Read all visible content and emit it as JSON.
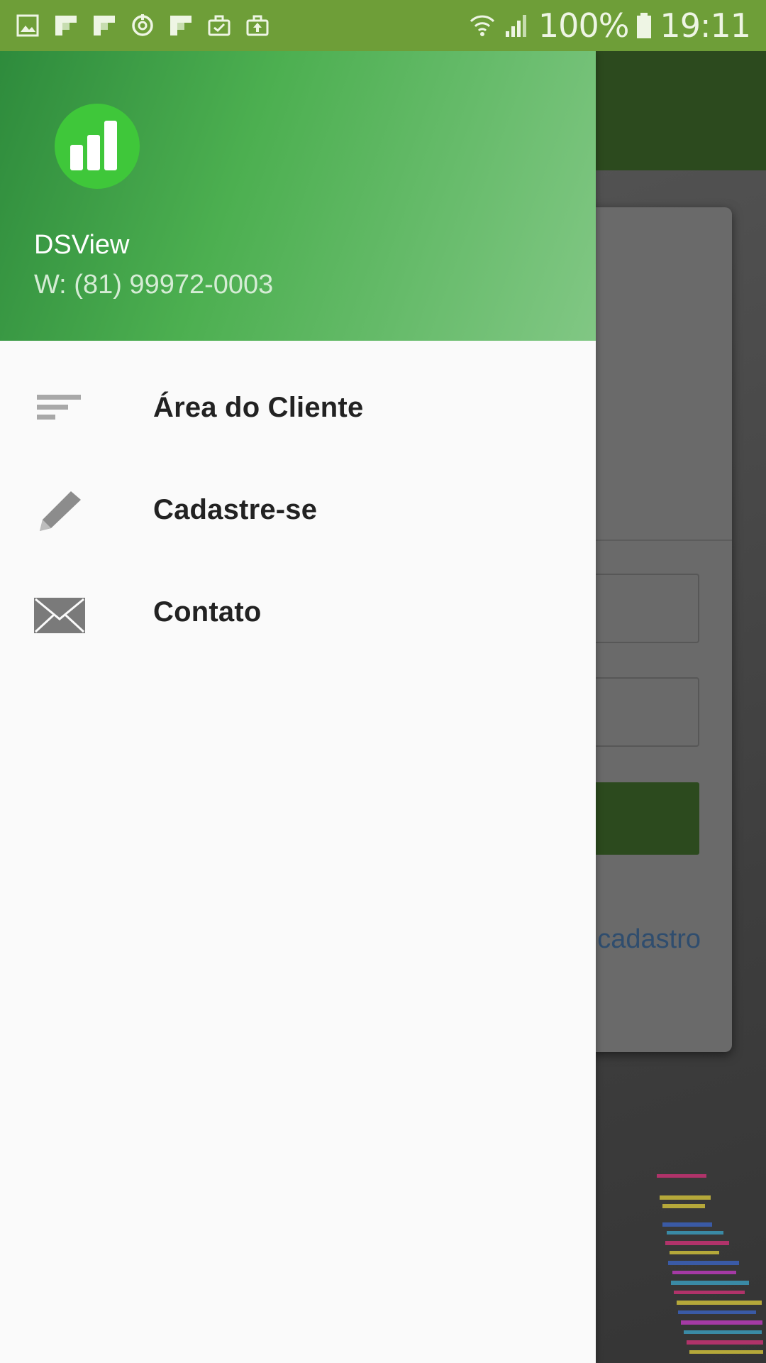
{
  "status_bar": {
    "battery": "100%",
    "time": "19:11",
    "left_icons": [
      "image-icon",
      "flipboard-icon",
      "flipboard-icon",
      "sync-icon",
      "flipboard-icon",
      "briefcase-check-icon",
      "briefcase-upload-icon"
    ],
    "right_icons": [
      "wifi-icon",
      "signal-icon",
      "battery-icon"
    ]
  },
  "drawer": {
    "header": {
      "app_name": "DSView",
      "phone": "W: (81) 99972-0003",
      "logo_icon": "bar-chart-icon",
      "gradient_start": "#2e8b3c",
      "gradient_end": "#81c784",
      "logo_color": "#3fc73a"
    },
    "items": [
      {
        "label": "Área do Cliente",
        "icon": "sort-lines-icon"
      },
      {
        "label": "Cadastre-se",
        "icon": "pencil-icon"
      },
      {
        "label": "Contato",
        "icon": "envelope-icon"
      }
    ]
  },
  "background": {
    "link_text": "cadastro",
    "accent_color": "#2c4a1e"
  }
}
